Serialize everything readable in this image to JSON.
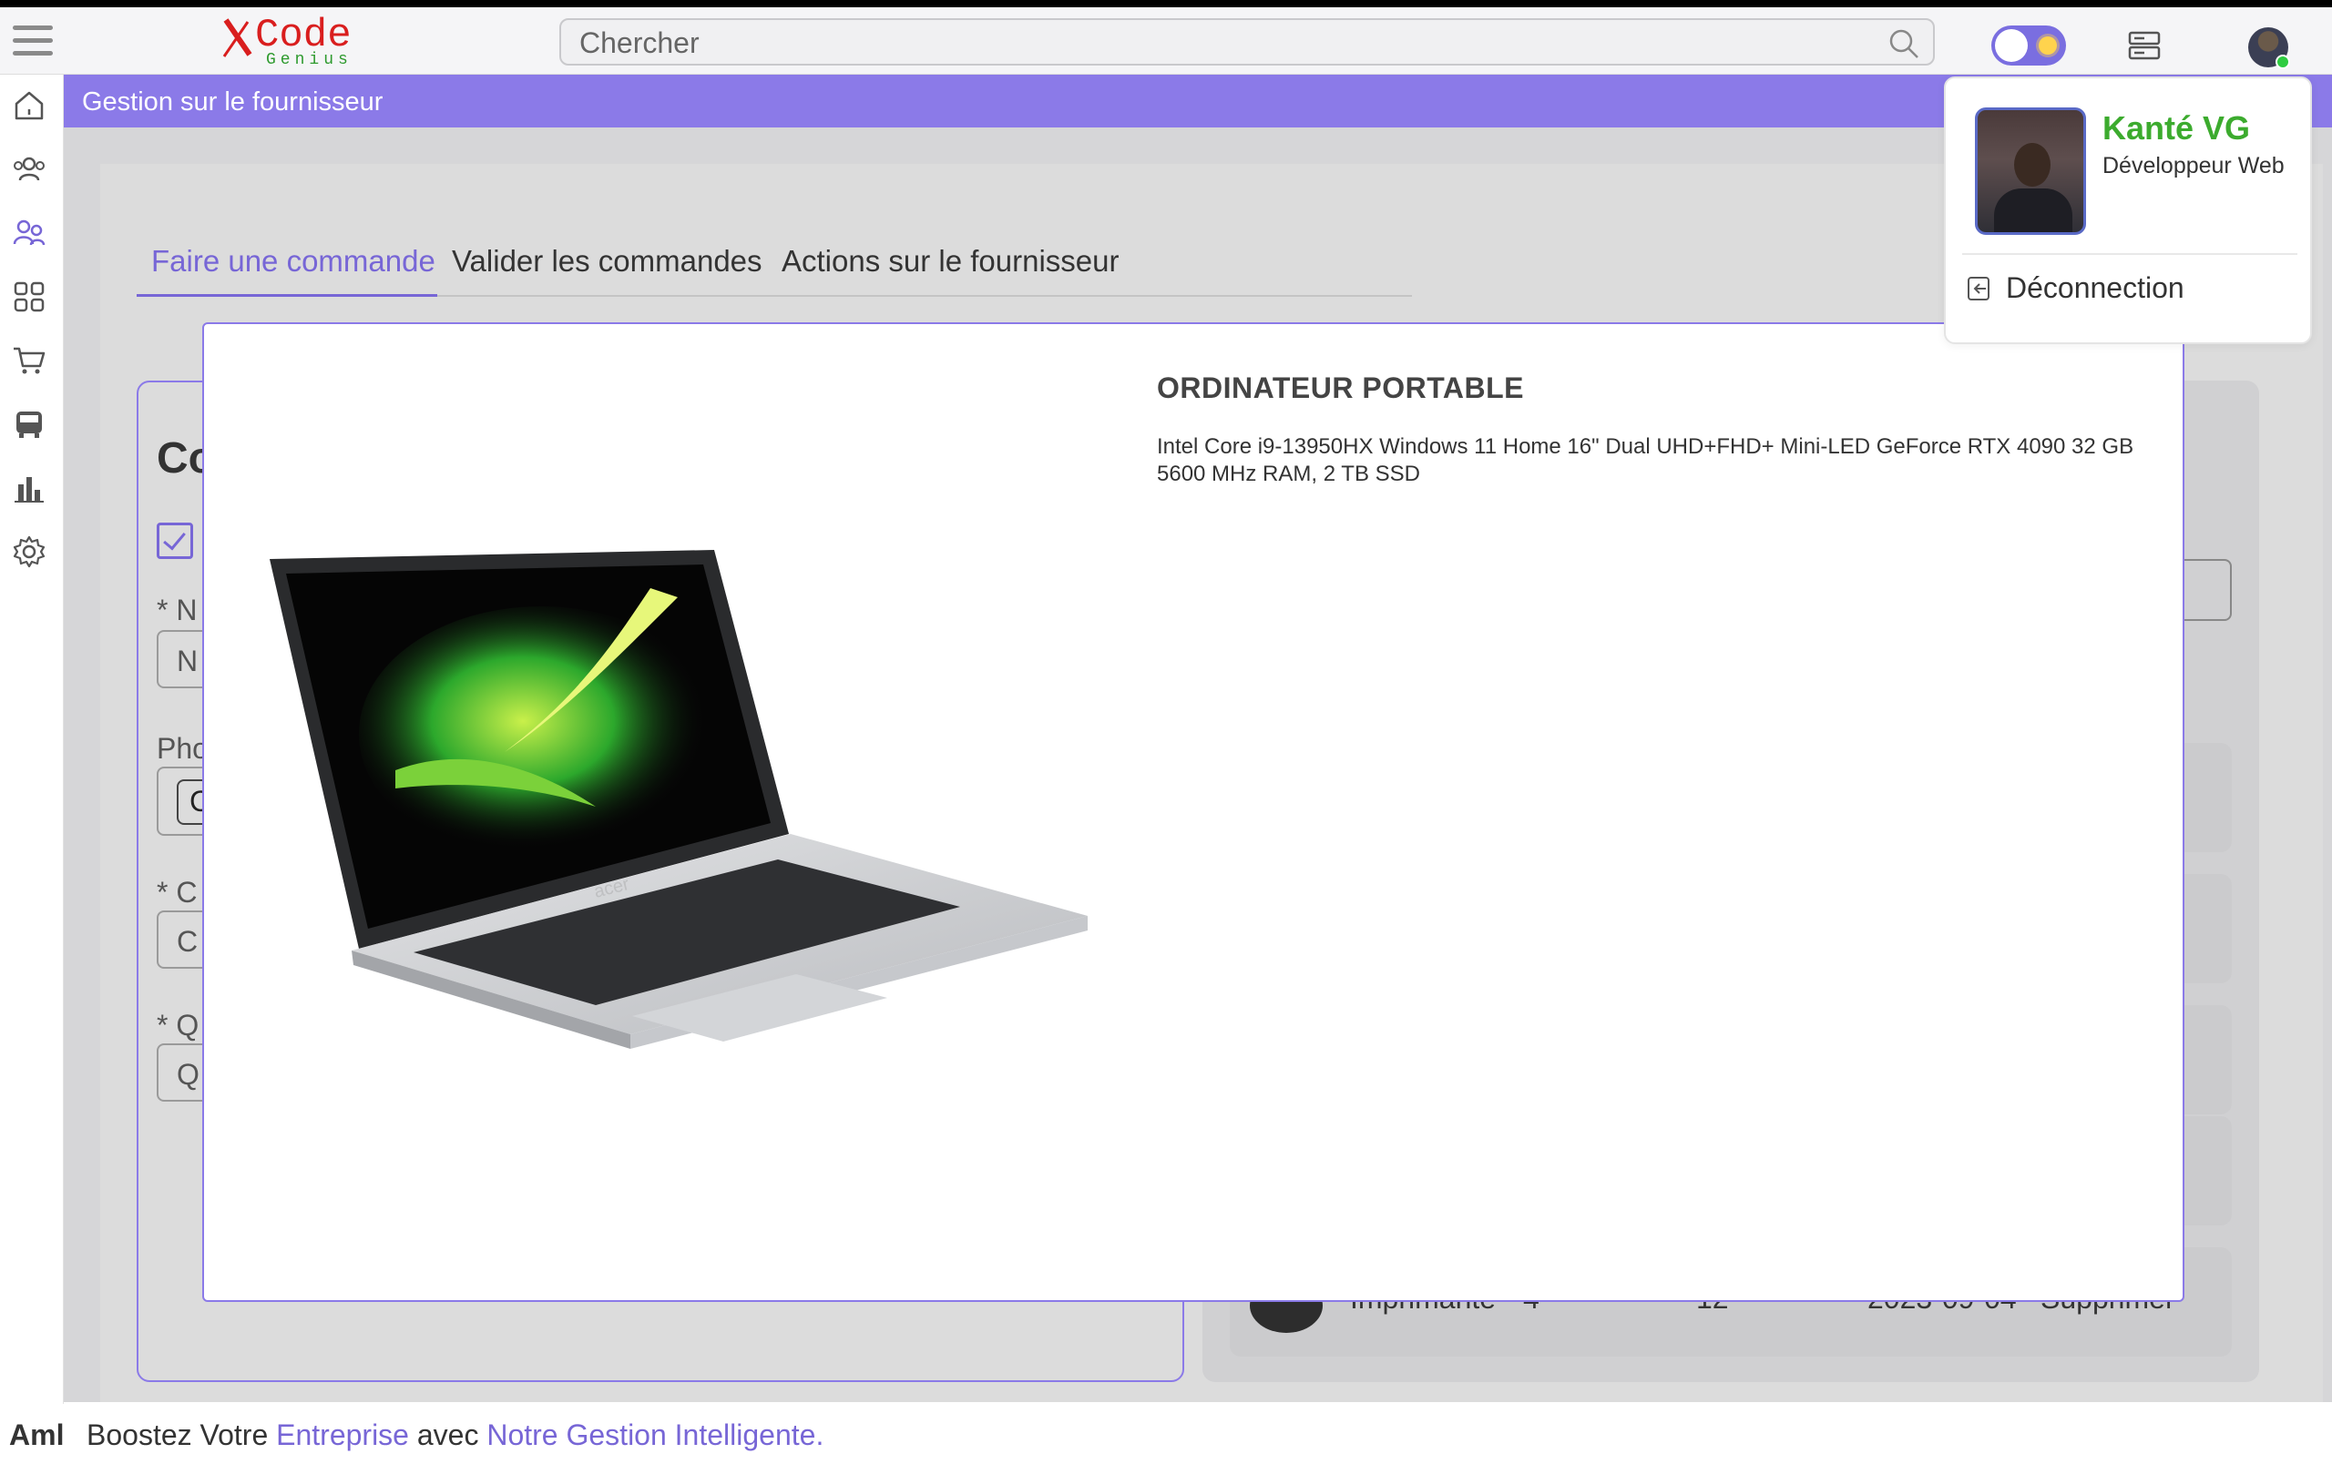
{
  "topbar": {
    "logo_main": "Code",
    "logo_sub": "Genius",
    "search_placeholder": "Chercher"
  },
  "page": {
    "title": "Gestion sur le fournisseur",
    "tabs": [
      {
        "label": "Faire une commande",
        "active": true
      },
      {
        "label": "Valider les commandes",
        "active": false
      },
      {
        "label": "Actions sur le fournisseur",
        "active": false
      }
    ]
  },
  "form_partial": {
    "heading": "Co",
    "field1_label": "* N",
    "field1_value": "N",
    "field2_label": "Pho",
    "field2_value": "C",
    "field3_label": "* C",
    "field3_value": "C",
    "field4_label": "* Q",
    "field4_value": "Q"
  },
  "table_partial": {
    "name": "Imprimante",
    "qty": "4",
    "price": "12",
    "date": "2023-09-04",
    "action": "Supprimer"
  },
  "modal": {
    "title": "ORDINATEUR PORTABLE",
    "description": "Intel Core i9-13950HX Windows 11 Home 16\" Dual UHD+FHD+ Mini-LED GeForce RTX 4090 32 GB 5600 MHz RAM, 2 TB SSD",
    "laptop_brand": "acer"
  },
  "user_menu": {
    "name": "Kanté VG",
    "role": "Développeur Web",
    "logout": "Déconnection"
  },
  "footer": {
    "brand": "Aml",
    "text_plain_1": "Boostez Votre ",
    "text_accent_1": "Entreprise",
    "text_plain_2": " avec ",
    "text_accent_2": "Notre Gestion Intelligente."
  },
  "colors": {
    "accent": "#8b7ae8",
    "accent_text": "#7766d6",
    "user_name": "#3cab2e",
    "status_online": "#2ecc40"
  },
  "icons": {
    "sidenav": [
      "home-icon",
      "users-icon",
      "suppliers-icon",
      "apps-grid-icon",
      "cart-icon",
      "bus-icon",
      "chart-icon",
      "settings-icon"
    ]
  }
}
